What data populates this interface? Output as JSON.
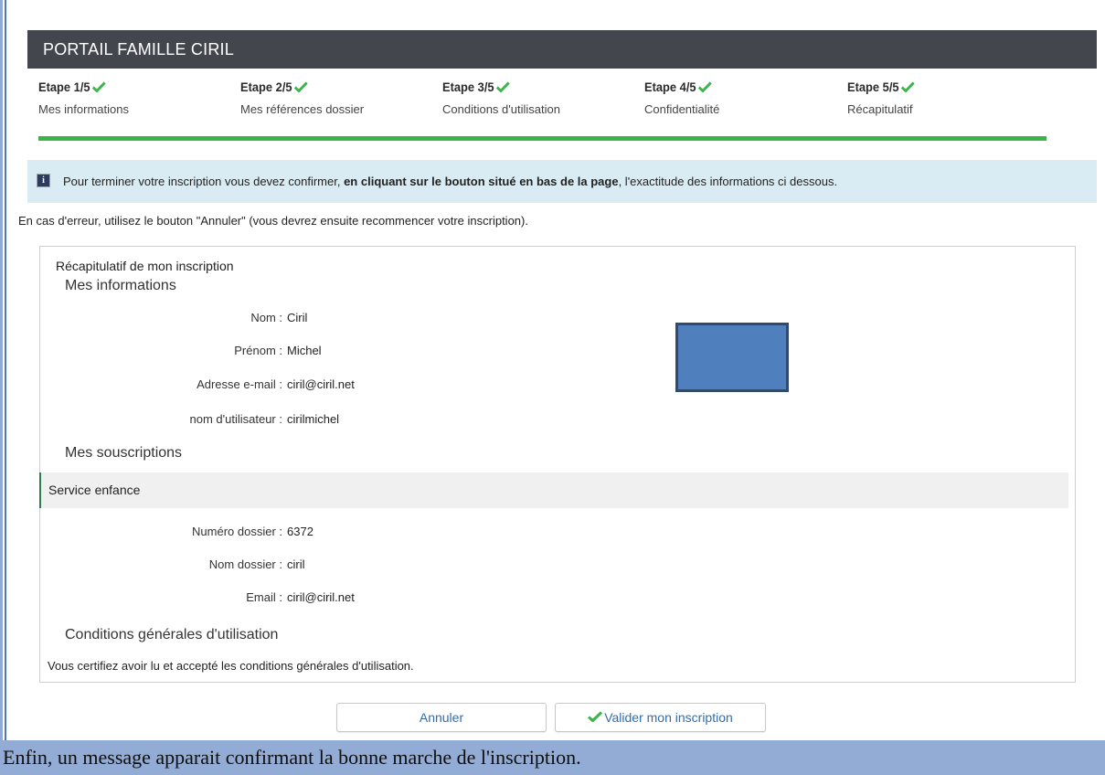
{
  "header": {
    "title": "PORTAIL FAMILLE CIRIL"
  },
  "colors": {
    "header_bg": "#43474d",
    "progress": "#3bb54a",
    "check": "#3bb54a",
    "banner_bg": "#d9ecf4",
    "link": "#2f6db0",
    "caption_bg": "#92acd5"
  },
  "steps": [
    {
      "title": "Etape 1/5",
      "subtitle": "Mes informations",
      "icon": "check-icon"
    },
    {
      "title": "Etape 2/5",
      "subtitle": "Mes références dossier",
      "icon": "check-icon"
    },
    {
      "title": "Etape 3/5",
      "subtitle": "Conditions d'utilisation",
      "icon": "check-icon"
    },
    {
      "title": "Etape 4/5",
      "subtitle": "Confidentialité",
      "icon": "check-icon"
    },
    {
      "title": "Etape 5/5",
      "subtitle": "Récapitulatif",
      "icon": "check-icon"
    }
  ],
  "info_banner": {
    "icon": "info-icon",
    "text_before": "Pour terminer votre inscription vous devez confirmer, ",
    "text_bold": "en cliquant sur le bouton situé en bas de la page",
    "text_after": ", l'exactitude des informations ci dessous."
  },
  "error_note": "En cas d'erreur, utilisez le bouton \"Annuler\" (vous devrez ensuite recommencer votre inscription).",
  "recap": {
    "title": "Récapitulatif de mon inscription",
    "mes_informations": {
      "heading": "Mes informations",
      "rows": [
        {
          "label": "Nom :",
          "value": "Ciril"
        },
        {
          "label": "Prénom :",
          "value": "Michel"
        },
        {
          "label": "Adresse e-mail :",
          "value": "ciril@ciril.net"
        },
        {
          "label": "nom d'utilisateur :",
          "value": "cirilmichel"
        }
      ]
    },
    "mes_souscriptions": {
      "heading": "Mes souscriptions",
      "service": "Service enfance",
      "rows": [
        {
          "label": "Numéro dossier :",
          "value": "6372"
        },
        {
          "label": "Nom dossier :",
          "value": "ciril"
        },
        {
          "label": "Email :",
          "value": "ciril@ciril.net"
        }
      ]
    },
    "cgu": {
      "heading": "Conditions générales d'utilisation",
      "text": "Vous certifiez avoir lu et accepté les conditions générales d'utilisation."
    }
  },
  "buttons": {
    "cancel": "Annuler",
    "validate": "Valider mon inscription"
  },
  "caption": "Enfin, un message apparait confirmant la bonne marche de l'inscription."
}
